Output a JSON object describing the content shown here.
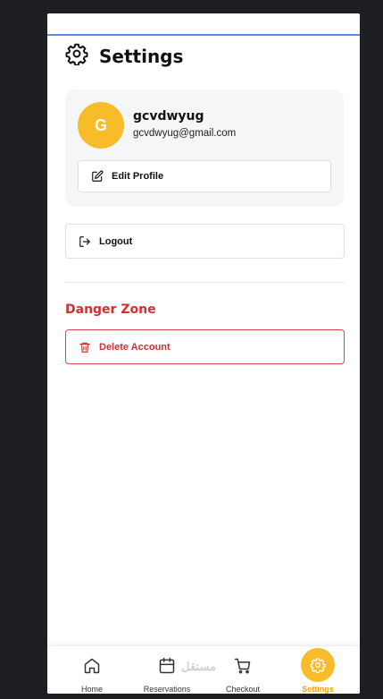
{
  "header": {
    "title": "Settings",
    "icon": "gear-icon"
  },
  "profile": {
    "initial": "G",
    "name": "gcvdwyug",
    "email": "gcvdwyug@gmail.com",
    "edit_label": "Edit Profile",
    "avatar_color": "#f8bb2a"
  },
  "logout": {
    "label": "Logout"
  },
  "danger_zone": {
    "title": "Danger Zone",
    "delete_label": "Delete Account",
    "color": "#d32f2f"
  },
  "nav": {
    "items": [
      {
        "label": "Home",
        "icon": "home-icon"
      },
      {
        "label": "Reservations",
        "icon": "calendar-icon"
      },
      {
        "label": "Checkout",
        "icon": "cart-icon"
      },
      {
        "label": "Settings",
        "icon": "gear-icon",
        "active": true
      }
    ],
    "active_color": "#f8bb2a"
  },
  "watermark": "مستقل"
}
